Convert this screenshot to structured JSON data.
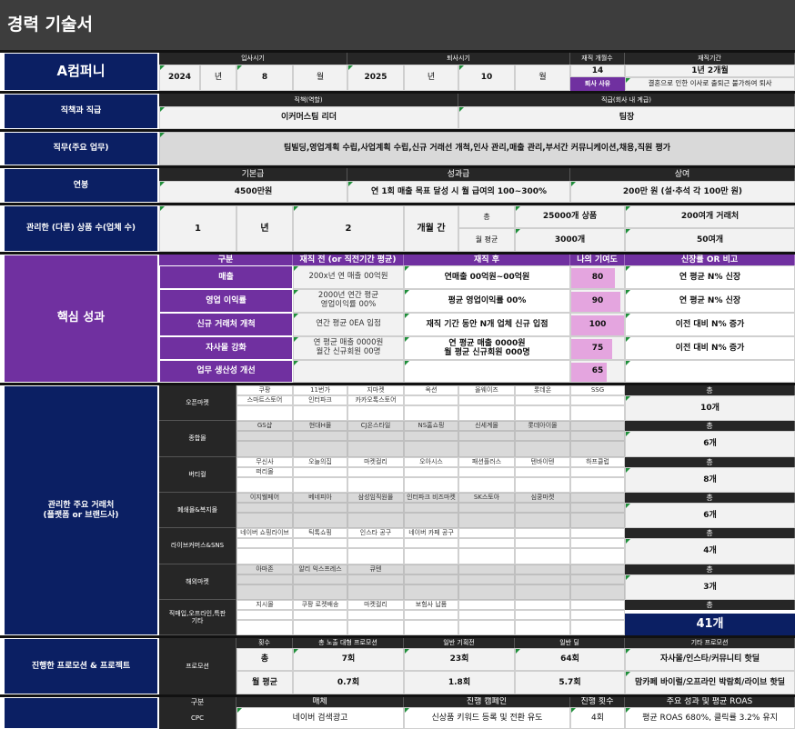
{
  "title": "경력 기술서",
  "company": {
    "name": "A컴퍼니",
    "join_label": "입사시기",
    "leave_label": "퇴사시기",
    "months_label": "재직 개월수",
    "tenure_label": "재직기간",
    "join_year": "2024",
    "join_year_unit": "년",
    "join_month": "8",
    "join_month_unit": "월",
    "leave_year": "2025",
    "leave_year_unit": "년",
    "leave_month": "10",
    "leave_month_unit": "월",
    "months": "14",
    "tenure": "1년 2개월",
    "leave_reason_label": "퇴사 사유",
    "leave_reason": "결혼으로 인한 이사로 출퇴근 불가하여 퇴사"
  },
  "position": {
    "label": "직책과 직급",
    "role_header": "직책(역할)",
    "rank_header": "직급(회사 내 계급)",
    "role": "이커머스팀 리더",
    "rank": "팀장"
  },
  "duty": {
    "label": "직무(주요 업무)",
    "text": "팀빌딩,영업계획 수립,사업계획 수립,신규 거래선 개척,인사 관리,매출 관리,부서간 커뮤니케이션,채용,직원 평가"
  },
  "salary": {
    "label": "연봉",
    "base_header": "기본급",
    "perf_header": "성과급",
    "bonus_header": "상여",
    "base": "4500만원",
    "perf": "연 1회 매출 목표 달성 시 월 급여의 100~300%",
    "bonus": "200만 원 (설·추석 각 100만 원)"
  },
  "products": {
    "label": "관리한 (다룬) 상품 수(업체 수)",
    "years": "1",
    "years_unit": "년",
    "months": "2",
    "months_unit": "개월 간",
    "total_label": "총",
    "monthly_label": "월 평균",
    "total_products": "25000개 상품",
    "total_partners": "200여개 거래처",
    "monthly_products": "3000개",
    "monthly_partners": "50여개"
  },
  "achievements": {
    "label": "핵심 성과",
    "headers": [
      "구분",
      "재직 전 (or 직전기간 평균)",
      "재직 후",
      "나의 기여도",
      "신장률 OR 비고"
    ],
    "rows": [
      {
        "name": "매출",
        "before": "200x년 연 매출 00억원",
        "after": "연매출 00억원~00억원",
        "contribution": 80,
        "note": "연 평균 N% 신장"
      },
      {
        "name": "영업 이익률",
        "before": "2000년 연간 평균\n영업이익률 00%",
        "after": "평균 영업이익률 00%",
        "contribution": 90,
        "note": "연 평균 N% 신장"
      },
      {
        "name": "신규 거래처 개척",
        "before": "연간 평균 0EA 입점",
        "after": "재직 기간 동안 N개 업체 신규 입점",
        "contribution": 100,
        "note": "이전 대비 N% 증가"
      },
      {
        "name": "자사몰 강화",
        "before": "연 평균 매출 0000원\n월간 신규회원 00명",
        "after": "연 평균 매출 0000원\n월 평균 신규회원 000명",
        "contribution": 75,
        "note": "이전 대비 N% 증가"
      },
      {
        "name": "업무 생산성 개선",
        "before": "",
        "after": "",
        "contribution": 65,
        "note": ""
      }
    ]
  },
  "partners": {
    "label": "관리한 주요 거래처\n(플랫폼 or 브랜드사)",
    "total_label": "총",
    "grand_total": "41개",
    "categories": [
      {
        "name": "오픈마켓",
        "row1": [
          "쿠팡",
          "11번가",
          "지마켓",
          "옥션",
          "올웨이즈",
          "롯데온",
          "SSG"
        ],
        "row2": [
          "스마트스토어",
          "인터파크",
          "카카오톡스토어",
          "",
          "",
          "",
          ""
        ],
        "count": "10개"
      },
      {
        "name": "종합몰",
        "row1": [
          "GS샵",
          "현대H몰",
          "CJ온스타일",
          "NS홈쇼핑",
          "신세계몰",
          "롯데아이몰",
          ""
        ],
        "row2": [
          "",
          "",
          "",
          "",
          "",
          "",
          ""
        ],
        "count": "6개"
      },
      {
        "name": "버티컬",
        "row1": [
          "무신사",
          "오늘의집",
          "마켓컬리",
          "오아시스",
          "패션플러스",
          "텐바이텐",
          "하프클럽"
        ],
        "row2": [
          "떠리몰",
          "",
          "",
          "",
          "",
          "",
          ""
        ],
        "count": "8개"
      },
      {
        "name": "폐쇄몰&복지몰",
        "row1": [
          "이지웰페어",
          "베네피아",
          "삼성임직원몰",
          "인터파크 비즈마켓",
          "SK스토아",
          "심쿵마켓",
          ""
        ],
        "row2": [
          "",
          "",
          "",
          "",
          "",
          "",
          ""
        ],
        "count": "6개"
      },
      {
        "name": "라이브커머스&SNS",
        "row1": [
          "네이버 쇼핑라이브",
          "틱톡쇼핑",
          "인스타 공구",
          "네이버 카페 공구",
          "",
          "",
          ""
        ],
        "row2": [
          "",
          "",
          "",
          "",
          "",
          "",
          ""
        ],
        "count": "4개"
      },
      {
        "name": "해외마켓",
        "row1": [
          "아마존",
          "알리 익스프레스",
          "큐텐",
          "",
          "",
          "",
          ""
        ],
        "row2": [
          "",
          "",
          "",
          "",
          "",
          "",
          ""
        ],
        "count": "3개"
      },
      {
        "name": "직매입,오프라인,특판\n기타",
        "row1": [
          "지시몰",
          "쿠팡 로켓배송",
          "마켓컬리",
          "보험사 납품",
          "",
          "",
          ""
        ],
        "row2": [
          "",
          "",
          "",
          "",
          "",
          "",
          ""
        ],
        "count": ""
      }
    ]
  },
  "promotions": {
    "label": "진행한 프로모션 & 프로젝트",
    "row_label": "프로모션",
    "headers": [
      "횟수",
      "총 노출 대형 프로모션",
      "일반 기획전",
      "일반 딜",
      "기타 프로모션"
    ],
    "total_label": "총",
    "monthly_label": "월 평균",
    "total": [
      "7회",
      "23회",
      "64회"
    ],
    "monthly": [
      "0.7회",
      "1.8회",
      "5.7회"
    ],
    "etc1": "자사몰/인스타/커뮤니티 핫딜",
    "etc2": "맘카페 바이럴/오프라인 박람회/라이브 핫딜"
  },
  "ads": {
    "headers": [
      "구분",
      "매체",
      "진행 캠페인",
      "진행 횟수",
      "주요 성과 및 평균 ROAS"
    ],
    "row": {
      "type": "CPC",
      "media": "네이버 검색광고",
      "campaign": "신상품 키워드 등록 및 전환 유도",
      "count": "4회",
      "result": "평균 ROAS 680%, 클릭률 3.2% 유지"
    }
  },
  "colors": {
    "navy": "#0b1f63",
    "purple": "#7030a0",
    "dark": "#262626",
    "pink_bar": "#e4a5df",
    "title_bar": "#3d3d3d"
  }
}
